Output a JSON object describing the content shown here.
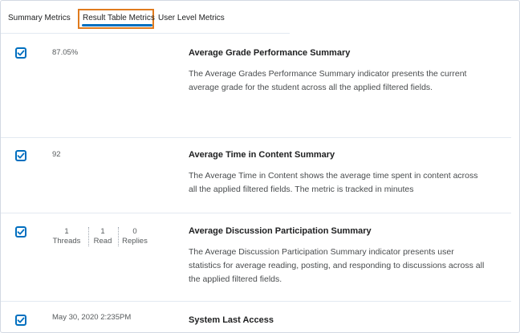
{
  "tabs": [
    {
      "label": "Summary Metrics",
      "active": false
    },
    {
      "label": "Result Table Metrics",
      "active": true
    },
    {
      "label": "User Level Metrics",
      "active": false
    }
  ],
  "colors": {
    "accent": "#006fbf",
    "focus_outline": "#e07b1e"
  },
  "metrics": [
    {
      "checked": true,
      "value": "87.05%",
      "title": "Average Grade Performance Summary",
      "description": "The Average Grades Performance Summary indicator presents the current average grade for the student across all the applied filtered fields."
    },
    {
      "checked": true,
      "value": "92",
      "title": "Average Time in Content Summary",
      "description": "The Average Time in Content shows the average time spent in content across all the applied filtered fields.  The metric is tracked in minutes"
    },
    {
      "checked": true,
      "stats": [
        {
          "value": "1",
          "label": "Threads"
        },
        {
          "value": "1",
          "label": "Read"
        },
        {
          "value": "0",
          "label": "Replies"
        }
      ],
      "title": "Average Discussion Participation Summary",
      "description": "The Average Discussion Participation Summary indicator presents user statistics for average reading, posting, and responding to discussions across all the applied filtered fields."
    },
    {
      "checked": true,
      "value": "May 30, 2020 2:235PM",
      "title": "System Last Access"
    }
  ]
}
